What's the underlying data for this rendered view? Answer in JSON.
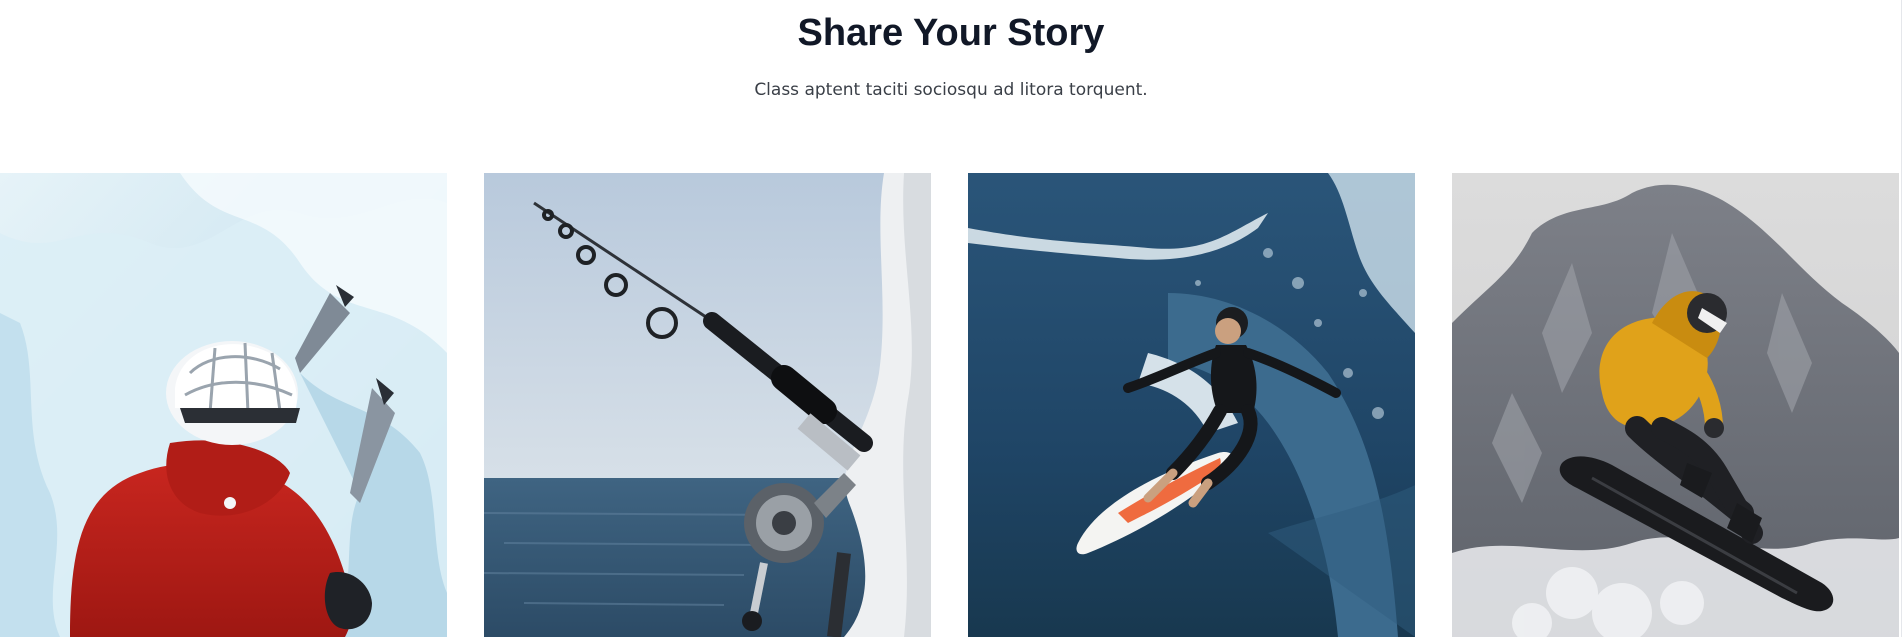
{
  "section": {
    "title": "Share Your Story",
    "subtitle": "Class aptent taciti sociosqu ad litora torquent."
  },
  "gallery": {
    "images": [
      {
        "name": "ice-climber-photo",
        "subject": "ice climber"
      },
      {
        "name": "fishing-rod-photo",
        "subject": "fishing rod over sea"
      },
      {
        "name": "surfer-photo",
        "subject": "surfer on wave"
      },
      {
        "name": "snowboarder-photo",
        "subject": "snowboarder jumping"
      }
    ]
  }
}
